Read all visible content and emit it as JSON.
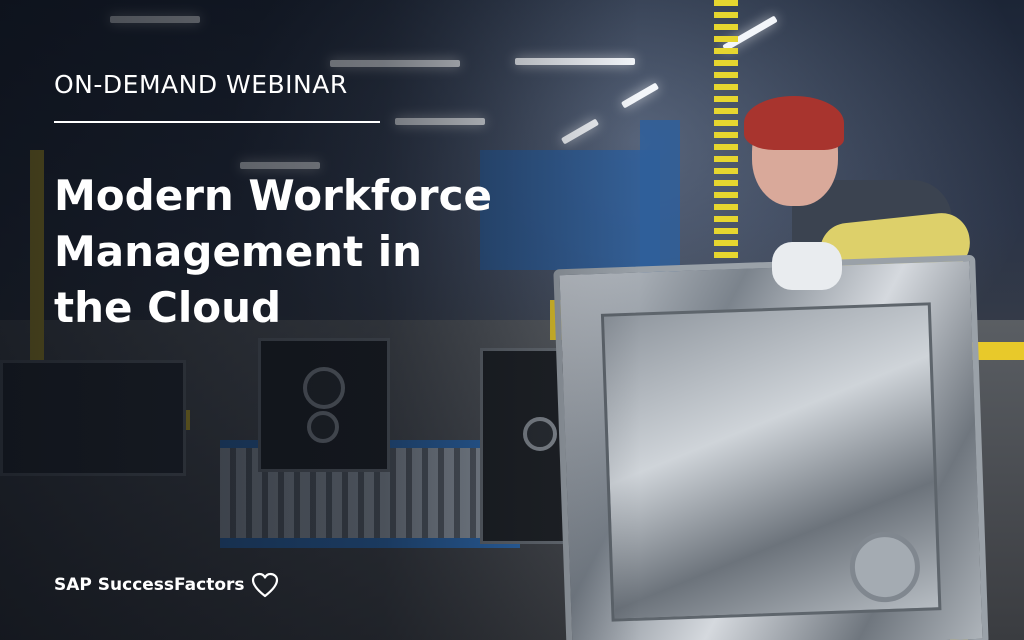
{
  "banner": {
    "eyebrow": "ON-DEMAND WEBINAR",
    "title_lines": [
      "Modern Workforce",
      "Management in",
      "the Cloud"
    ],
    "brand": "SAP SuccessFactors",
    "brand_icon": "heart-outline-icon"
  },
  "photo": {
    "subject": "factory-worker-with-steel-dishwasher-tub"
  },
  "colors": {
    "text": "#ffffff",
    "accent_yellow": "#e8c92a",
    "accent_blue": "#2f6fb8"
  }
}
